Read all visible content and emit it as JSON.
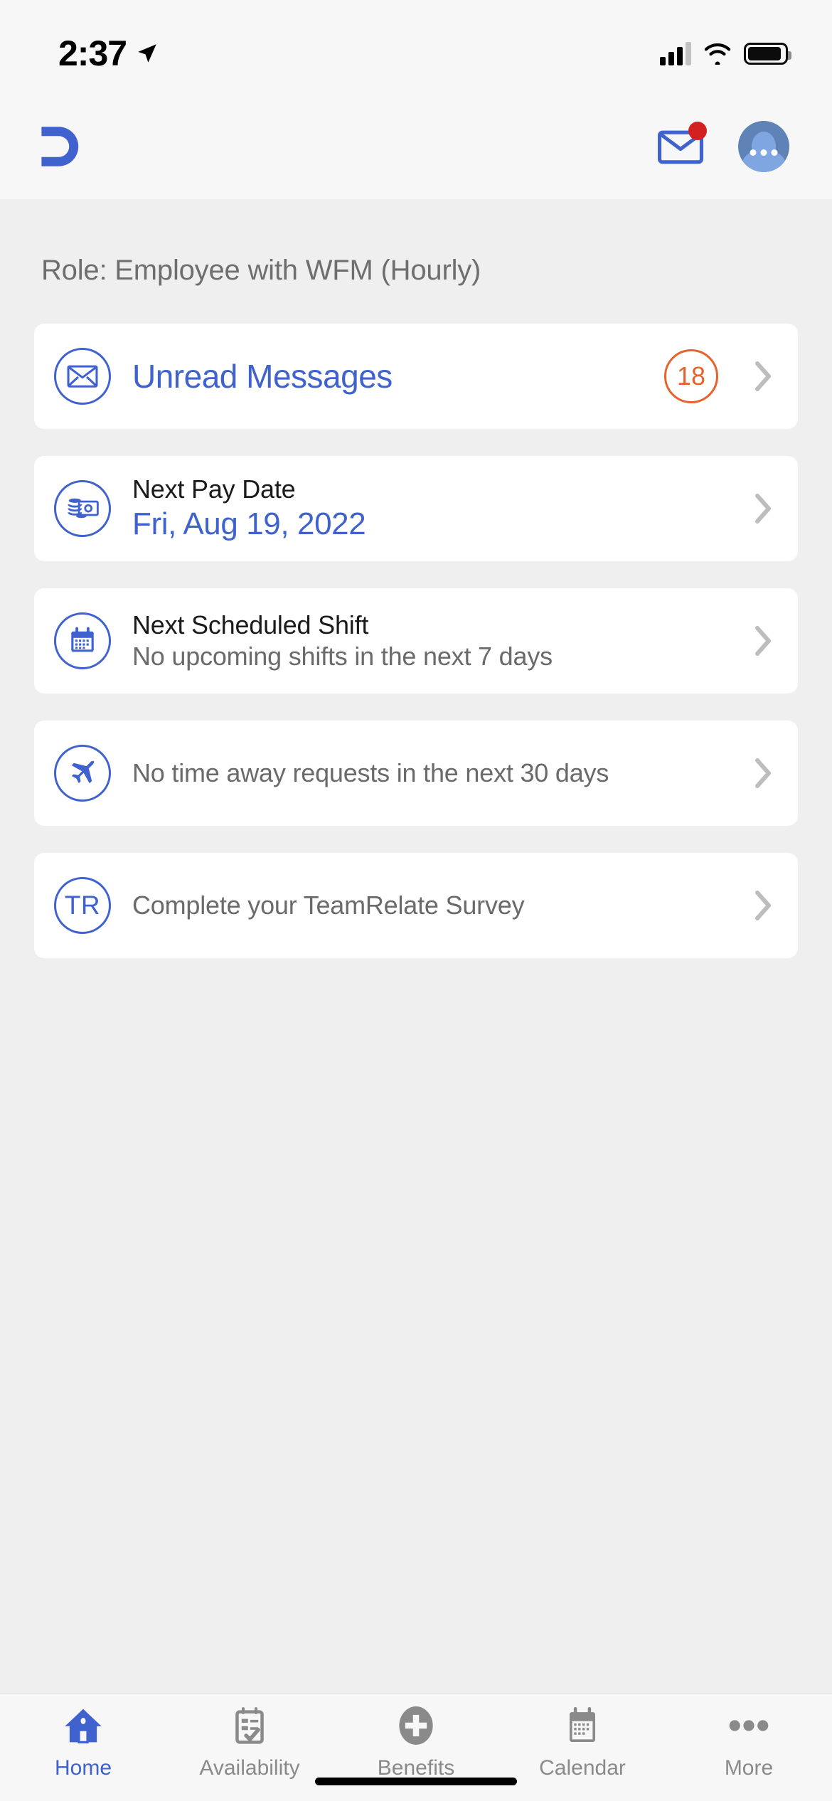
{
  "status_bar": {
    "time": "2:37",
    "location_icon": "location-arrow-icon",
    "cellular_icon": "cellular-signal-icon",
    "wifi_icon": "wifi-icon",
    "battery_icon": "battery-icon"
  },
  "header": {
    "logo": "dayforce-d-logo",
    "mail_icon": "envelope-icon",
    "mail_has_notification": true,
    "avatar_icon": "user-avatar-icon"
  },
  "role_line": "Role: Employee with WFM (Hourly)",
  "colors": {
    "brand_blue": "#3F62CE",
    "badge_orange": "#E8622C",
    "notification_red": "#D32020",
    "page_background": "#EFEFEF",
    "card_background": "#FFFFFF",
    "muted_text": "#6A6A6A"
  },
  "cards": [
    {
      "name": "unread-messages",
      "icon": "envelope-circle-icon",
      "title": "Unread Messages",
      "badge": "18",
      "chevron": "chevron-right-icon"
    },
    {
      "name": "next-pay-date",
      "icon": "money-circle-icon",
      "title": "Next Pay Date",
      "value": "Fri, Aug 19, 2022",
      "chevron": "chevron-right-icon"
    },
    {
      "name": "next-scheduled-shift",
      "icon": "calendar-circle-icon",
      "title": "Next Scheduled Shift",
      "value": "No upcoming shifts in the next 7 days",
      "chevron": "chevron-right-icon"
    },
    {
      "name": "time-away-requests",
      "icon": "airplane-circle-icon",
      "title": "No time away requests in the next 30 days",
      "chevron": "chevron-right-icon"
    },
    {
      "name": "teamrelate-survey",
      "icon": "teamrelate-circle-icon",
      "icon_text": "TR",
      "title": "Complete your TeamRelate Survey",
      "chevron": "chevron-right-icon"
    }
  ],
  "tab_bar": {
    "items": [
      {
        "label": "Home",
        "icon": "home-icon",
        "active": true
      },
      {
        "label": "Availability",
        "icon": "clipboard-check-icon",
        "active": false
      },
      {
        "label": "Benefits",
        "icon": "medical-cross-icon",
        "active": false
      },
      {
        "label": "Calendar",
        "icon": "calendar-icon",
        "active": false
      },
      {
        "label": "More",
        "icon": "ellipsis-icon",
        "active": false
      }
    ]
  }
}
